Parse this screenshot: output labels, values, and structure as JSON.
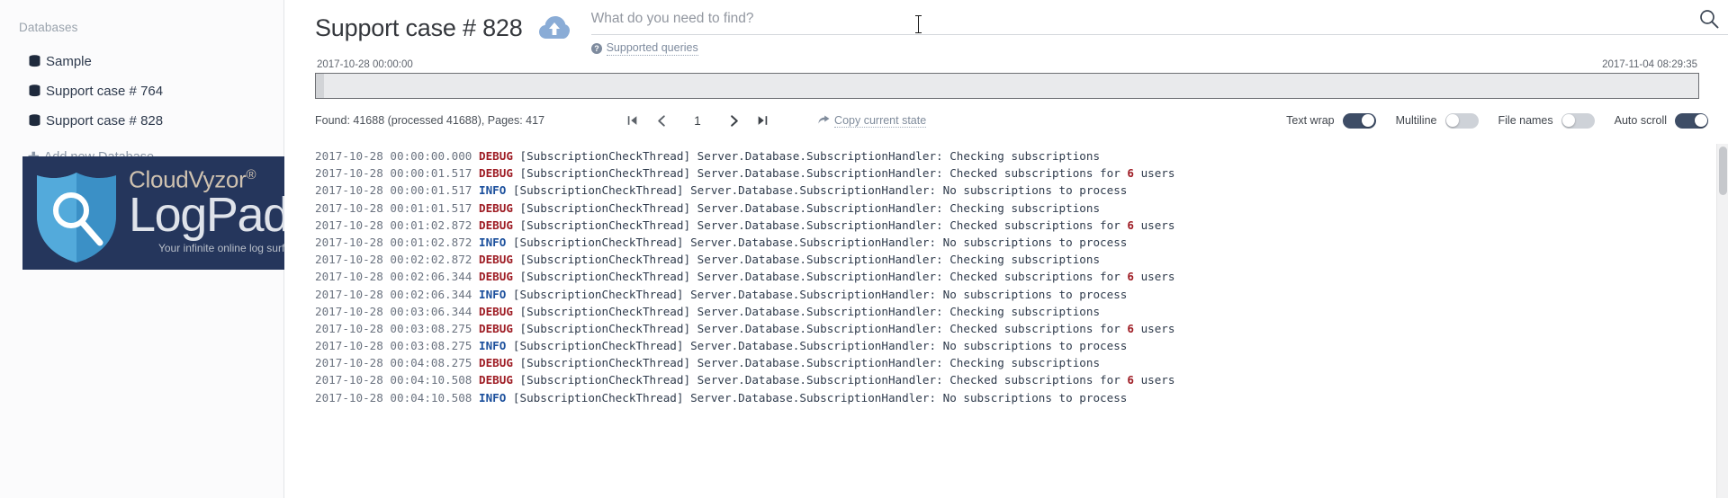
{
  "sidebar": {
    "heading": "Databases",
    "items": [
      {
        "label": "Sample",
        "icon": "database-icon"
      },
      {
        "label": "Support case # 764",
        "icon": "database-icon"
      },
      {
        "label": "Support case # 828",
        "icon": "database-icon"
      }
    ],
    "add_database_label": "Add new Database",
    "add_database_icon": "plus-icon"
  },
  "logo": {
    "brand": "CloudVyzor",
    "registered_mark": "®",
    "product": "LogPad",
    "tagline": "Your infinite online log surfing tool",
    "shield_icon": "shield-magnifier-icon",
    "background_color": "#25365c",
    "brand_color": "#cfc2b0",
    "product_color": "#dfe3ea"
  },
  "header": {
    "title": "Support case # 828",
    "upload_icon": "cloud-upload-icon",
    "search": {
      "value": "",
      "placeholder": "What do you need to find?",
      "icon": "search-icon"
    },
    "supported_queries": {
      "label": "Supported queries",
      "icon": "question-circle-icon"
    }
  },
  "timeline": {
    "start_label": "2017-10-28 00:00:00",
    "end_label": "2017-11-04 08:29:35"
  },
  "toolbar": {
    "found_text": "Found: 41688 (processed 41688), Pages: 417",
    "pager": {
      "first_icon": "first-page-icon",
      "prev_icon": "chevron-left-icon",
      "page_value": "1",
      "next_icon": "chevron-right-icon",
      "last_icon": "last-page-icon"
    },
    "copy_state": {
      "label": "Copy current state",
      "icon": "share-icon"
    },
    "toggles": [
      {
        "label": "Text wrap",
        "state": "on"
      },
      {
        "label": "Multiline",
        "state": "off"
      },
      {
        "label": "File names",
        "state": "off"
      },
      {
        "label": "Auto scroll",
        "state": "on"
      }
    ]
  },
  "log": {
    "accent_debug_color": "#9e1c24",
    "accent_info_color": "#1b4f9c",
    "lines": [
      {
        "ts": "2017-10-28 00:00:00.000",
        "level": "DEBUG",
        "thread": "[SubscriptionCheckThread]",
        "logger": "Server.Database.SubscriptionHandler:",
        "msg": "Checking subscriptions",
        "num": ""
      },
      {
        "ts": "2017-10-28 00:00:01.517",
        "level": "DEBUG",
        "thread": "[SubscriptionCheckThread]",
        "logger": "Server.Database.SubscriptionHandler:",
        "msg": "Checked subscriptions for",
        "num": "6",
        "msg2": "users"
      },
      {
        "ts": "2017-10-28 00:00:01.517",
        "level": "INFO",
        "thread": "[SubscriptionCheckThread]",
        "logger": "Server.Database.SubscriptionHandler:",
        "msg": "No subscriptions to process",
        "num": ""
      },
      {
        "ts": "2017-10-28 00:01:01.517",
        "level": "DEBUG",
        "thread": "[SubscriptionCheckThread]",
        "logger": "Server.Database.SubscriptionHandler:",
        "msg": "Checking subscriptions",
        "num": ""
      },
      {
        "ts": "2017-10-28 00:01:02.872",
        "level": "DEBUG",
        "thread": "[SubscriptionCheckThread]",
        "logger": "Server.Database.SubscriptionHandler:",
        "msg": "Checked subscriptions for",
        "num": "6",
        "msg2": "users"
      },
      {
        "ts": "2017-10-28 00:01:02.872",
        "level": "INFO",
        "thread": "[SubscriptionCheckThread]",
        "logger": "Server.Database.SubscriptionHandler:",
        "msg": "No subscriptions to process",
        "num": ""
      },
      {
        "ts": "2017-10-28 00:02:02.872",
        "level": "DEBUG",
        "thread": "[SubscriptionCheckThread]",
        "logger": "Server.Database.SubscriptionHandler:",
        "msg": "Checking subscriptions",
        "num": ""
      },
      {
        "ts": "2017-10-28 00:02:06.344",
        "level": "DEBUG",
        "thread": "[SubscriptionCheckThread]",
        "logger": "Server.Database.SubscriptionHandler:",
        "msg": "Checked subscriptions for",
        "num": "6",
        "msg2": "users"
      },
      {
        "ts": "2017-10-28 00:02:06.344",
        "level": "INFO",
        "thread": "[SubscriptionCheckThread]",
        "logger": "Server.Database.SubscriptionHandler:",
        "msg": "No subscriptions to process",
        "num": ""
      },
      {
        "ts": "2017-10-28 00:03:06.344",
        "level": "DEBUG",
        "thread": "[SubscriptionCheckThread]",
        "logger": "Server.Database.SubscriptionHandler:",
        "msg": "Checking subscriptions",
        "num": ""
      },
      {
        "ts": "2017-10-28 00:03:08.275",
        "level": "DEBUG",
        "thread": "[SubscriptionCheckThread]",
        "logger": "Server.Database.SubscriptionHandler:",
        "msg": "Checked subscriptions for",
        "num": "6",
        "msg2": "users"
      },
      {
        "ts": "2017-10-28 00:03:08.275",
        "level": "INFO",
        "thread": "[SubscriptionCheckThread]",
        "logger": "Server.Database.SubscriptionHandler:",
        "msg": "No subscriptions to process",
        "num": ""
      },
      {
        "ts": "2017-10-28 00:04:08.275",
        "level": "DEBUG",
        "thread": "[SubscriptionCheckThread]",
        "logger": "Server.Database.SubscriptionHandler:",
        "msg": "Checking subscriptions",
        "num": ""
      },
      {
        "ts": "2017-10-28 00:04:10.508",
        "level": "DEBUG",
        "thread": "[SubscriptionCheckThread]",
        "logger": "Server.Database.SubscriptionHandler:",
        "msg": "Checked subscriptions for",
        "num": "6",
        "msg2": "users"
      },
      {
        "ts": "2017-10-28 00:04:10.508",
        "level": "INFO",
        "thread": "[SubscriptionCheckThread]",
        "logger": "Server.Database.SubscriptionHandler:",
        "msg": "No subscriptions to process",
        "num": ""
      }
    ]
  }
}
